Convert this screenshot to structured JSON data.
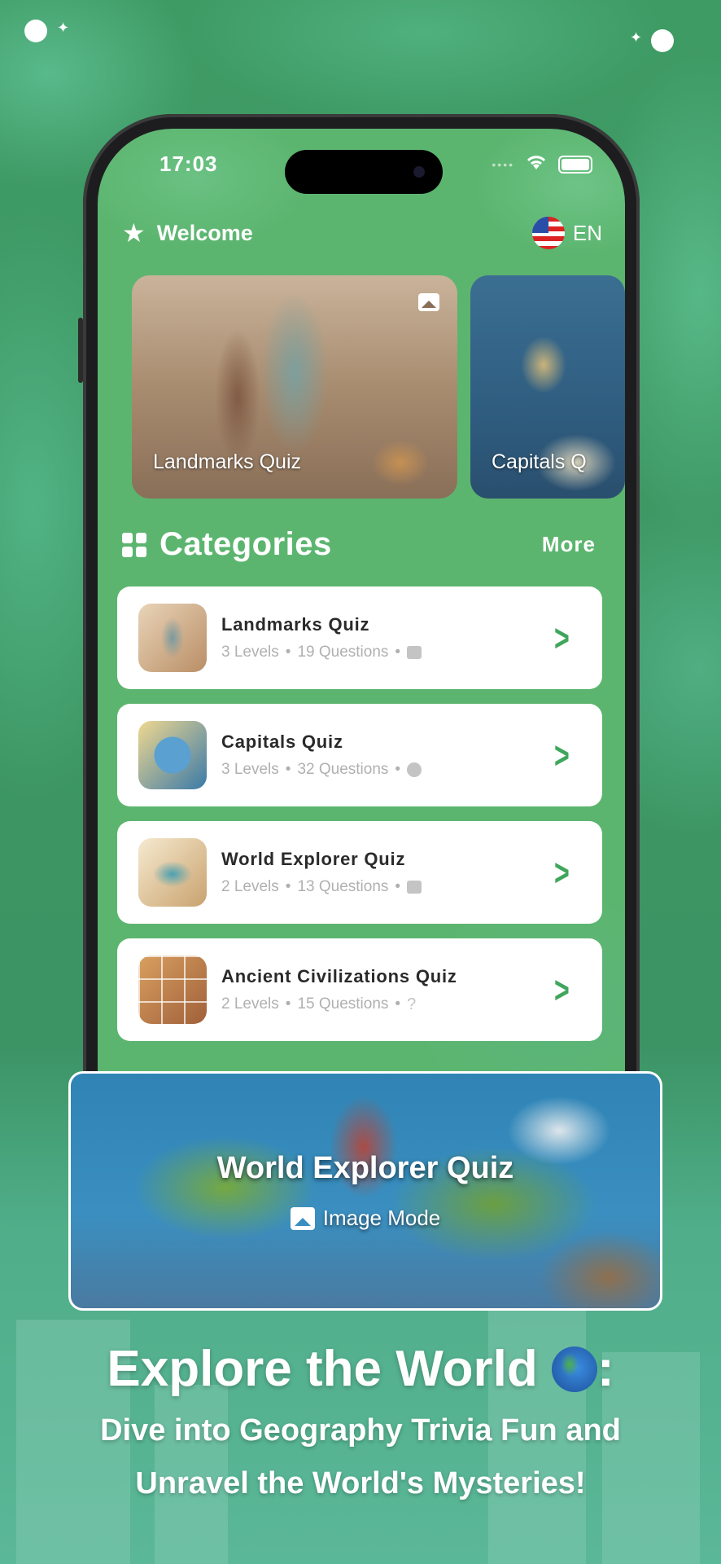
{
  "status_bar": {
    "time": "17:03"
  },
  "header": {
    "welcome": "Welcome",
    "language": "EN"
  },
  "banners": [
    {
      "label": "Landmarks Quiz"
    },
    {
      "label": "Capitals Q"
    }
  ],
  "categories": {
    "title": "Categories",
    "more": "More",
    "items": [
      {
        "title": "Landmarks Quiz",
        "levels": "3 Levels",
        "questions": "19 Questions",
        "mode_icon": "image-icon"
      },
      {
        "title": "Capitals Quiz",
        "levels": "3 Levels",
        "questions": "32 Questions",
        "mode_icon": "timer-icon"
      },
      {
        "title": "World Explorer Quiz",
        "levels": "2 Levels",
        "questions": "13 Questions",
        "mode_icon": "image-icon"
      },
      {
        "title": "Ancient Civilizations Quiz",
        "levels": "2 Levels",
        "questions": "15 Questions",
        "mode_icon": "question-icon"
      }
    ]
  },
  "feature": {
    "title": "World Explorer Quiz",
    "mode": "Image Mode"
  },
  "promo": {
    "headline": "Explore the World",
    "headline_suffix": ":",
    "line1": "Dive into Geography Trivia Fun and",
    "line2": "Unravel the World's Mysteries!"
  },
  "colors": {
    "accent": "#3fa65c",
    "screen_bg": "#5cb56f",
    "page_bg": "#3e9a66"
  }
}
